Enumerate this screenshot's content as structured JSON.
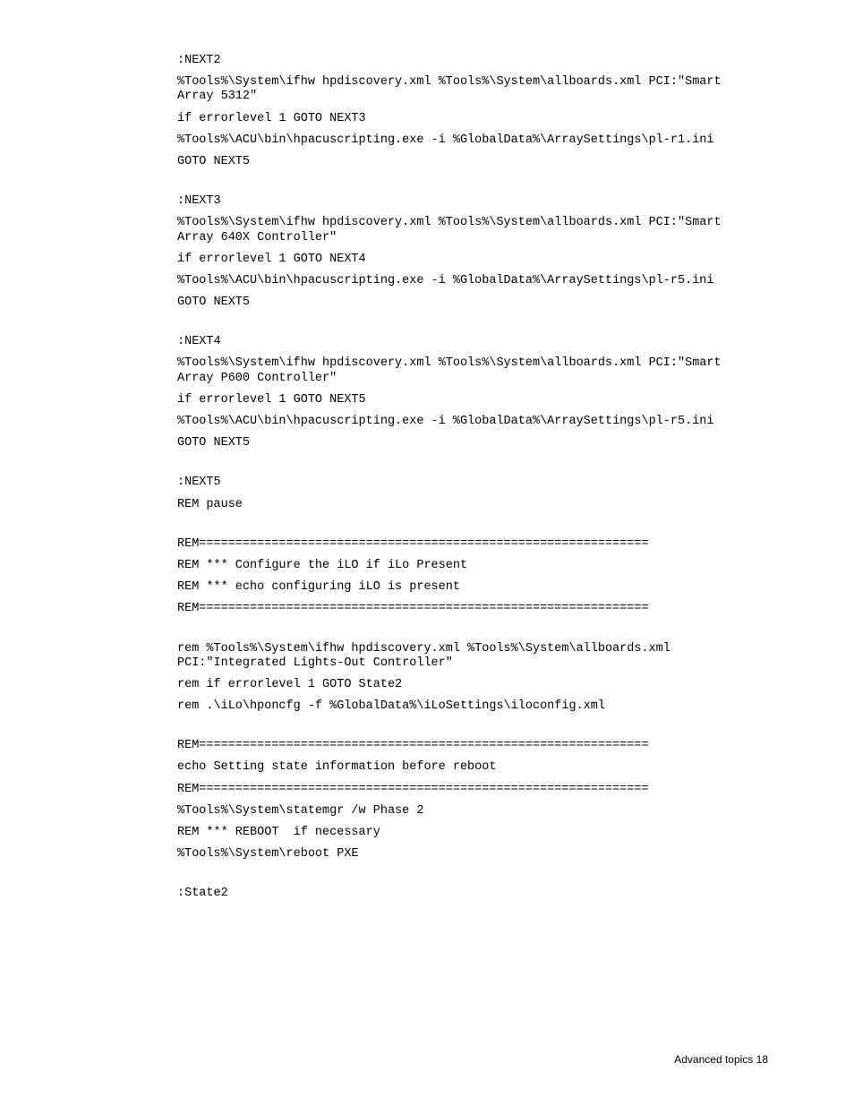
{
  "code": {
    "b1_l1": ":NEXT2",
    "b1_l2": "%Tools%\\System\\ifhw hpdiscovery.xml %Tools%\\System\\allboards.xml PCI:\"Smart Array 5312\"",
    "b1_l3": "if errorlevel 1 GOTO NEXT3",
    "b1_l4": "%Tools%\\ACU\\bin\\hpacuscripting.exe -i %GlobalData%\\ArraySettings\\pl-r1.ini",
    "b1_l5": "GOTO NEXT5",
    "b2_l1": ":NEXT3",
    "b2_l2": "%Tools%\\System\\ifhw hpdiscovery.xml %Tools%\\System\\allboards.xml PCI:\"Smart Array 640X Controller\"",
    "b2_l3": "if errorlevel 1 GOTO NEXT4",
    "b2_l4": "%Tools%\\ACU\\bin\\hpacuscripting.exe -i %GlobalData%\\ArraySettings\\pl-r5.ini",
    "b2_l5": "GOTO NEXT5",
    "b3_l1": ":NEXT4",
    "b3_l2": "%Tools%\\System\\ifhw hpdiscovery.xml %Tools%\\System\\allboards.xml PCI:\"Smart Array P600 Controller\"",
    "b3_l3": "if errorlevel 1 GOTO NEXT5",
    "b3_l4": "%Tools%\\ACU\\bin\\hpacuscripting.exe -i %GlobalData%\\ArraySettings\\pl-r5.ini",
    "b3_l5": "GOTO NEXT5",
    "b4_l1": ":NEXT5",
    "b4_l2": "REM pause",
    "b5_l1": "REM==============================================================",
    "b5_l2": "REM *** Configure the iLO if iLo Present",
    "b5_l3": "REM *** echo configuring iLO is present",
    "b5_l4": "REM==============================================================",
    "b6_l1": "rem %Tools%\\System\\ifhw hpdiscovery.xml %Tools%\\System\\allboards.xml PCI:\"Integrated Lights-Out Controller\"",
    "b6_l2": "rem if errorlevel 1 GOTO State2",
    "b6_l3": "rem .\\iLo\\hponcfg -f %GlobalData%\\iLoSettings\\iloconfig.xml",
    "b7_l1": "REM==============================================================",
    "b7_l2": "echo Setting state information before reboot",
    "b7_l3": "REM==============================================================",
    "b7_l4": "%Tools%\\System\\statemgr /w Phase 2",
    "b7_l5": "REM *** REBOOT  if necessary",
    "b7_l6": "%Tools%\\System\\reboot PXE",
    "b8_l1": ":State2"
  },
  "footer": {
    "text": "Advanced topics   18"
  }
}
